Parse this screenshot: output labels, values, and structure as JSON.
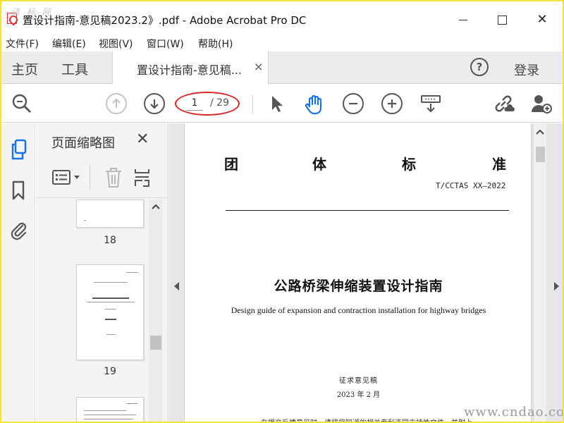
{
  "window": {
    "title": "置设计指南-意见稿2023.2》.pdf - Adobe Acrobat Pro DC",
    "watermark": "请 标 网"
  },
  "menu": [
    "文件(F)",
    "编辑(E)",
    "视图(V)",
    "窗口(W)",
    "帮助(H)"
  ],
  "tabs": {
    "home": "主页",
    "tools": "工具",
    "document": "置设计指南-意见稿...",
    "close": "×",
    "help": "?",
    "login": "登录"
  },
  "toolbar": {
    "page_current": "1",
    "page_total": "/ 29",
    "icons": [
      "search-zoom-icon",
      "prev-page-icon",
      "next-page-icon",
      "select-cursor-icon",
      "hand-tool-icon",
      "zoom-out-icon",
      "zoom-in-icon",
      "keyboard-tool-icon",
      "share-link-icon",
      "add-user-icon"
    ]
  },
  "rail": {
    "icons": [
      "page-thumbnails-icon",
      "bookmark-icon",
      "attachment-icon"
    ]
  },
  "thumbnails": {
    "header": "页面缩略图",
    "close": "✕",
    "pages": [
      {
        "number": "18"
      },
      {
        "number": "19"
      }
    ]
  },
  "document": {
    "standard_chars": [
      "团",
      "体",
      "标",
      "准"
    ],
    "standard_code": "T/CCTAS XX—2022",
    "title": "公路桥梁伸缩装置设计指南",
    "subtitle": "Design guide of expansion and contraction installation for highway bridges",
    "status": "征求意见稿",
    "date": "2023 年 2 月",
    "partial_line": "在提交反馈意见时，请将您知道的相关专利连同支持性文件一并附上"
  },
  "site_watermark": "www.cndao.com",
  "colors": {
    "accent_blue": "#1473e6",
    "highlight_red": "#d82727",
    "frame_yellow": "#f2e23a"
  }
}
